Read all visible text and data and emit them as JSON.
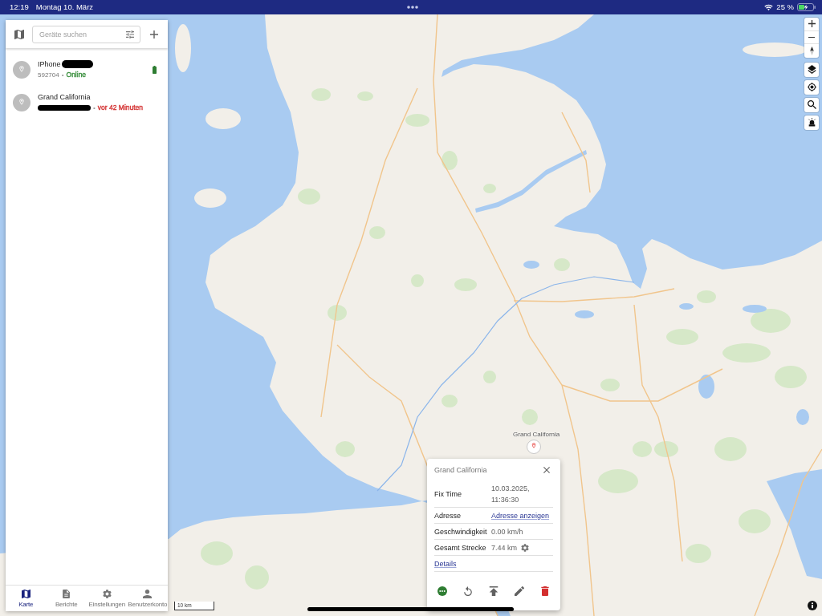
{
  "status_bar": {
    "time": "12:19",
    "date": "Montag 10. März",
    "battery": "25 %"
  },
  "sidebar": {
    "search": {
      "placeholder": "Geräte suchen"
    },
    "devices": [
      {
        "name": "IPhone",
        "name_redacted": true,
        "id": "592704",
        "id_redacted": false,
        "separator": "•",
        "status": "Online",
        "color": "#388e3c",
        "battery_icon": true
      },
      {
        "name": "Grand California",
        "name_redacted": false,
        "id_redacted": true,
        "separator": "•",
        "status": "vor 42 Minuten",
        "color": "#d32f2f",
        "battery_icon": false
      }
    ],
    "nav": [
      {
        "label": "Karte",
        "kind": "map",
        "selected": true
      },
      {
        "label": "Berichte",
        "kind": "reports",
        "selected": false
      },
      {
        "label": "Einstellungen",
        "kind": "settings",
        "selected": false
      },
      {
        "label": "Benutzerkonto",
        "kind": "account",
        "selected": false
      }
    ]
  },
  "map": {
    "marker_label": "Grand California",
    "scale": "10 km"
  },
  "popup": {
    "title": "Grand California",
    "fields": [
      {
        "label": "Fix Time",
        "value": "10.03.2025, 11:36:30",
        "kind": "text"
      },
      {
        "label": "Adresse",
        "value": "Adresse anzeigen",
        "kind": "link"
      },
      {
        "label": "Geschwindigkeit",
        "value": "0.00 km/h",
        "kind": "text"
      },
      {
        "label": "Gesamt Strecke",
        "value": "7.44 km",
        "kind": "setting"
      }
    ],
    "link": "Details"
  }
}
